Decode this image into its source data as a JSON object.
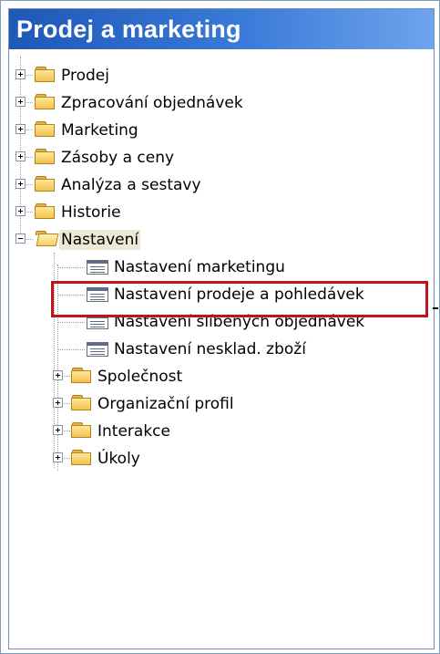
{
  "panel": {
    "title": "Prodej a marketing"
  },
  "tree": {
    "items": [
      {
        "label": "Prodej",
        "type": "folder",
        "state": "collapsed",
        "level": 0
      },
      {
        "label": "Zpracování objednávek",
        "type": "folder",
        "state": "collapsed",
        "level": 0
      },
      {
        "label": "Marketing",
        "type": "folder",
        "state": "collapsed",
        "level": 0
      },
      {
        "label": "Zásoby a ceny",
        "type": "folder",
        "state": "collapsed",
        "level": 0
      },
      {
        "label": "Analýza a sestavy",
        "type": "folder",
        "state": "collapsed",
        "level": 0
      },
      {
        "label": "Historie",
        "type": "folder",
        "state": "collapsed",
        "level": 0
      },
      {
        "label": "Nastavení",
        "type": "folder",
        "state": "expanded",
        "level": 0,
        "selected": true
      },
      {
        "label": "Nastavení marketingu",
        "type": "form",
        "level": 1
      },
      {
        "label": "Nastavení prodeje a pohledávek",
        "type": "form",
        "level": 1,
        "highlighted": true
      },
      {
        "label": "Nastavení slíbených objednávek",
        "type": "form",
        "level": 1
      },
      {
        "label": "Nastavení nesklad. zboží",
        "type": "form",
        "level": 1
      },
      {
        "label": "Společnost",
        "type": "folder",
        "state": "collapsed",
        "level": 1
      },
      {
        "label": "Organizační profil",
        "type": "folder",
        "state": "collapsed",
        "level": 1
      },
      {
        "label": "Interakce",
        "type": "folder",
        "state": "collapsed",
        "level": 1
      },
      {
        "label": "Úkoly",
        "type": "folder",
        "state": "collapsed",
        "level": 1
      }
    ]
  },
  "colors": {
    "header_start": "#1e58b8",
    "header_end": "#6fa4ec",
    "highlight_border": "#c0141b",
    "selection_background": "#ece9d8"
  }
}
